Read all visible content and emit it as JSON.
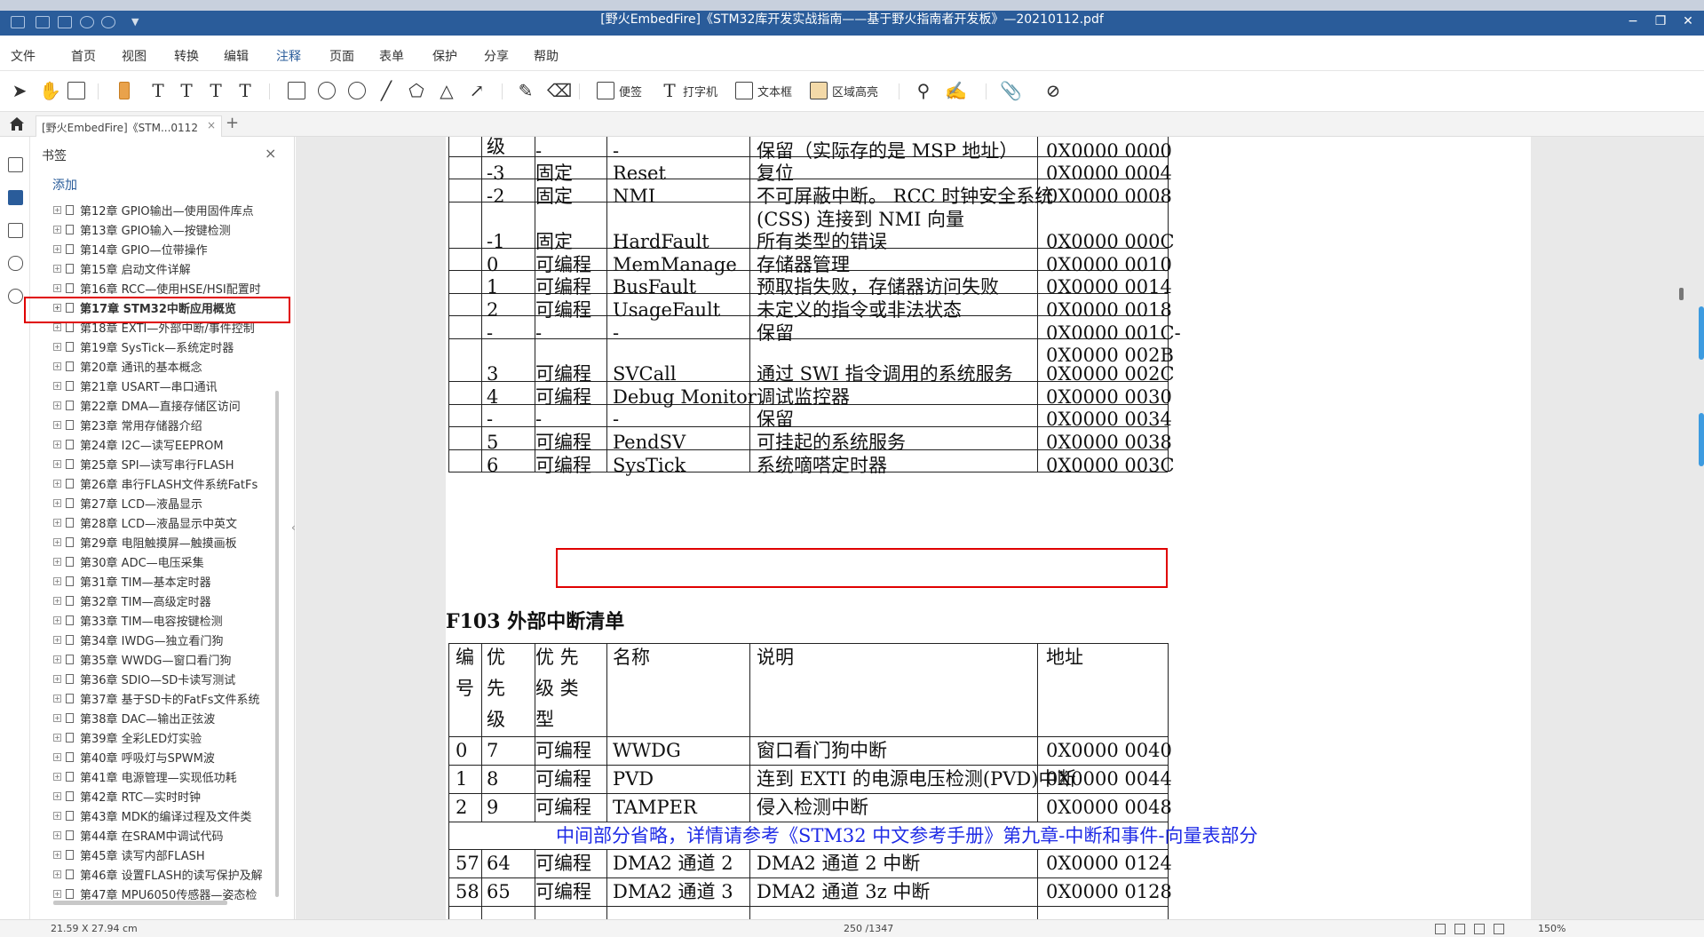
{
  "titlebar": {
    "title": "[野火EmbedFire]《STM32库开发实战指南——基于野火指南者开发板》—20210112.pdf",
    "minimize": "−",
    "restore": "❐",
    "close": "✕"
  },
  "menubar": {
    "items": [
      "文件",
      "首页",
      "视图",
      "转换",
      "编辑",
      "注释",
      "页面",
      "表单",
      "保护",
      "分享",
      "帮助"
    ],
    "active": "注释"
  },
  "toolbar": {
    "labels": {
      "note": "便签",
      "typewriter": "打字机",
      "textbox": "文本框",
      "area_highlight": "区域高亮"
    }
  },
  "tabbar": {
    "tab_label": "[野火EmbedFire]《STM...0112",
    "close": "×",
    "new_tab": "+"
  },
  "bookmarks": {
    "title": "书签",
    "close": "×",
    "add": "添加",
    "items": [
      "第12章 GPIO输出—使用固件库点",
      "第13章 GPIO输入—按键检测",
      "第14章 GPIO—位带操作",
      "第15章 启动文件详解",
      "第16章 RCC—使用HSE/HSI配置时",
      "第17章 STM32中断应用概览",
      "第18章 EXTI—外部中断/事件控制",
      "第19章 SysTick—系统定时器",
      "第20章 通讯的基本概念",
      "第21章 USART—串口通讯",
      "第22章 DMA—直接存储区访问",
      "第23章 常用存储器介绍",
      "第24章 I2C—读写EEPROM",
      "第25章 SPI—读写串行FLASH",
      "第26章 串行FLASH文件系统FatFs",
      "第27章 LCD—液晶显示",
      "第28章 LCD—液晶显示中英文",
      "第29章 电阻触摸屏—触摸画板",
      "第30章 ADC—电压采集",
      "第31章 TIM—基本定时器",
      "第32章 TIM—高级定时器",
      "第33章 TIM—电容按键检测",
      "第34章 IWDG—独立看门狗",
      "第35章 WWDG—窗口看门狗",
      "第36章 SDIO—SD卡读写测试",
      "第37章 基于SD卡的FatFs文件系统",
      "第38章 DAC—输出正弦波",
      "第39章 全彩LED灯实验",
      "第40章 呼吸灯与SPWM波",
      "第41章 电源管理—实现低功耗",
      "第42章 RTC—实时时钟",
      "第43章 MDK的编译过程及文件类",
      "第44章 在SRAM中调试代码",
      "第45章 读写内部FLASH",
      "第46章 设置FLASH的读写保护及解",
      "第47章 MPU6050传感器—姿态检"
    ],
    "selected_index": 5
  },
  "document": {
    "table1_partial_header": "级",
    "table1_rows": [
      [
        "-",
        "-",
        "-",
        "保留（实际存的是 MSP 地址）",
        "0X0000 0000"
      ],
      [
        "-3",
        "固定",
        "Reset",
        " 复位",
        "0X0000 0004"
      ],
      [
        "-2",
        "固定",
        "NMI",
        "不可屏蔽中断。 RCC 时钟安全系统",
        "0X0000 0008"
      ],
      [
        "",
        "",
        "",
        "(CSS) 连接到 NMI 向量",
        ""
      ],
      [
        "-1",
        "固定",
        "HardFault",
        "所有类型的错误",
        "0X0000 000C"
      ],
      [
        "0",
        "可编程",
        "MemManage",
        "存储器管理",
        "0X0000 0010"
      ],
      [
        "1",
        "可编程",
        "BusFault",
        "预取指失败，存储器访问失败",
        "0X0000 0014"
      ],
      [
        "2",
        "可编程",
        "UsageFault",
        "未定义的指令或非法状态",
        "0X0000 0018"
      ],
      [
        "-",
        "-",
        "-",
        "保留",
        "0X0000 001C-"
      ],
      [
        "",
        "",
        "",
        "",
        "0X0000 002B"
      ],
      [
        "3",
        "可编程",
        "SVCall",
        "通过 SWI 指令调用的系统服务",
        "0X0000 002C"
      ],
      [
        "4",
        "可编程",
        "Debug Monitor",
        "调试监控器",
        "0X0000 0030"
      ],
      [
        "-",
        "-",
        "-",
        "保留",
        "0X0000 0034"
      ],
      [
        "5",
        "可编程",
        "PendSV",
        "可挂起的系统服务",
        "0X0000 0038"
      ],
      [
        "6",
        "可编程",
        "SysTick",
        "系统嘀嗒定时器",
        "0X0000 003C"
      ]
    ],
    "section_title": "F103 外部中断清单",
    "table2_header": [
      [
        "编",
        "优",
        "优  先",
        "名称",
        "说明",
        "地址"
      ],
      [
        "号",
        "先",
        "级  类",
        "",
        "",
        ""
      ],
      [
        "",
        "级",
        "型",
        "",
        "",
        ""
      ]
    ],
    "table2_rows": [
      [
        "0",
        "7",
        "可编程",
        "WWDG",
        "窗口看门狗中断",
        "0X0000 0040"
      ],
      [
        "1",
        "8",
        "可编程",
        "PVD",
        "连到 EXTI 的电源电压检测(PVD)中断",
        "0X0000 0044"
      ],
      [
        "2",
        "9",
        "可编程",
        "TAMPER",
        "侵入检测中断",
        "0X0000 0048"
      ]
    ],
    "omitted_note": "中间部分省略，详情请参考《STM32 中文参考手册》第九章-中断和事件-向量表部分",
    "table2_rows_after": [
      [
        "57",
        "64",
        "可编程",
        "DMA2 通道 2",
        "DMA2 通道 2 中断",
        "0X0000 0124"
      ],
      [
        "58",
        "65",
        "可编程",
        "DMA2 通道 3",
        "DMA2 通道 3z 中断",
        "0X0000 0128"
      ]
    ]
  },
  "statusbar": {
    "page_size": "21.59 X 27.94 cm",
    "page_number": "250 /1347",
    "zoom": "150%"
  },
  "colors": {
    "titlebar": "#2a5c9a",
    "highlight_box": "#e00000",
    "note_text": "#1f2be6"
  }
}
